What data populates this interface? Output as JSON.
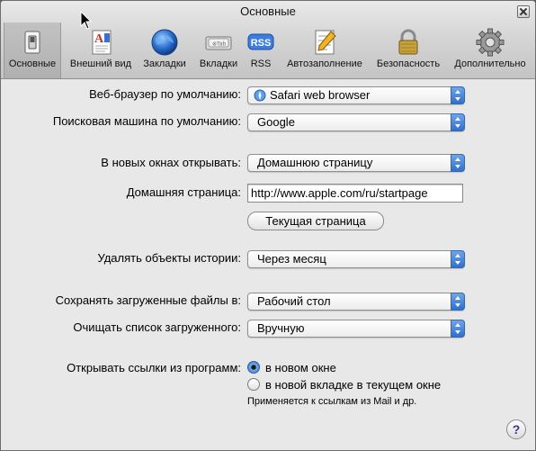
{
  "window": {
    "title": "Основные"
  },
  "toolbar": {
    "tabs": [
      {
        "label": "Основные",
        "icon": "switch-icon"
      },
      {
        "label": "Внешний вид",
        "icon": "font-document-icon"
      },
      {
        "label": "Закладки",
        "icon": "globe-icon"
      },
      {
        "label": "Вкладки",
        "icon": "tabs-icon"
      },
      {
        "label": "RSS",
        "icon": "rss-icon"
      },
      {
        "label": "Автозаполнение",
        "icon": "pencil-form-icon"
      },
      {
        "label": "Безопасность",
        "icon": "lock-icon"
      },
      {
        "label": "Дополнительно",
        "icon": "gear-icon"
      }
    ],
    "selected": "Основные"
  },
  "form": {
    "default_browser": {
      "label": "Веб-браузер по умолчанию:",
      "value": "Safari web browser"
    },
    "search_engine": {
      "label": "Поисковая машина по умолчанию:",
      "value": "Google"
    },
    "new_windows": {
      "label": "В новых окнах открывать:",
      "value": "Домашнюю страницу"
    },
    "homepage": {
      "label": "Домашняя страница:",
      "value": "http://www.apple.com/ru/startpage"
    },
    "current_page_button": "Текущая страница",
    "remove_history": {
      "label": "Удалять объекты истории:",
      "value": "Через месяц"
    },
    "save_downloads": {
      "label": "Сохранять загруженные файлы в:",
      "value": "Рабочий стол"
    },
    "clear_downloads": {
      "label": "Очищать список загруженного:",
      "value": "Вручную"
    },
    "open_links": {
      "label": "Открывать ссылки из программ:",
      "options": [
        "в новом окне",
        "в новой вкладке в текущем окне"
      ],
      "selected": "в новом окне",
      "note": "Применяется к ссылкам из Mail и др."
    }
  },
  "help_label": "?",
  "colors": {
    "accent": "#2f6fcf",
    "window_bg": "#e8e8e8"
  }
}
